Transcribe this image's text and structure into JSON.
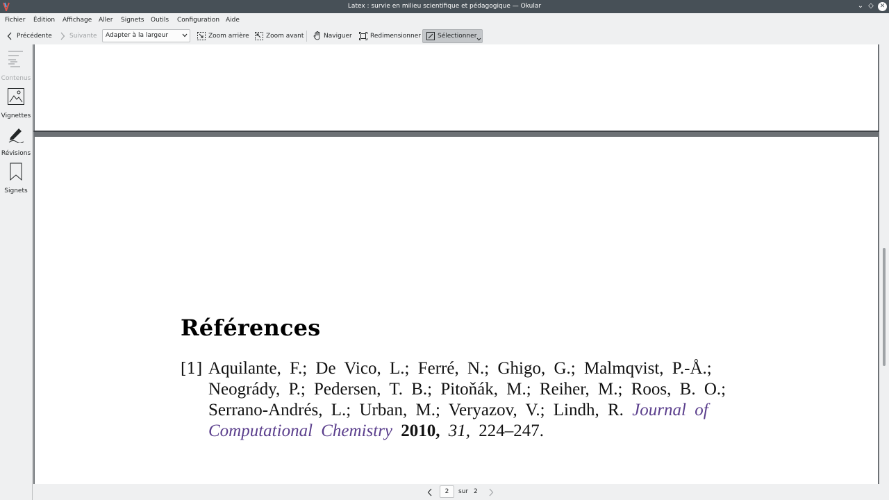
{
  "window": {
    "title": "Latex : survie en milieu scientifique et pédagogique — Okular",
    "controls": {
      "minimize": "⌄",
      "maximize": "◇",
      "close": "✕"
    }
  },
  "menubar": {
    "items": [
      "Fichier",
      "Édition",
      "Affichage",
      "Aller",
      "Signets",
      "Outils",
      "Configuration",
      "Aide"
    ]
  },
  "toolbar": {
    "previous": "Précédente",
    "next": "Suivante",
    "zoom_mode": "Adapter à la largeur",
    "zoom_out": "Zoom arrière",
    "zoom_in": "Zoom avant",
    "browse": "Naviguer",
    "resize": "Redimensionner",
    "select": "Sélectionner"
  },
  "sidebar": {
    "items": [
      {
        "label": "Contenus",
        "icon": "table-of-contents-icon",
        "enabled": false
      },
      {
        "label": "Vignettes",
        "icon": "thumbnails-icon",
        "enabled": true
      },
      {
        "label": "Révisions",
        "icon": "annotations-pen-icon",
        "enabled": true
      },
      {
        "label": "Signets",
        "icon": "bookmark-icon",
        "enabled": true
      }
    ]
  },
  "document": {
    "heading": "Références",
    "reference": {
      "number": "[1]",
      "lines": [
        "Aquilante, F.; De Vico, L.; Ferré, N.; Ghigo, G.; Malmqvist, P.-Å.;",
        "Neogrády, P.; Pedersen, T. B.; Pitoňák, M.; Reiher, M.; Roos, B. O.;",
        "Serrano-Andrés, L.; Urban, M.; Veryazov, V.; Lindh, R."
      ],
      "journal_part1": "Journal of",
      "journal_part2": "Computational Chemistry",
      "year": "2010,",
      "volume": "31,",
      "pages": "224–247."
    }
  },
  "pagebar": {
    "current_page": "2",
    "of_label": "sur",
    "total_pages": "2"
  },
  "colors": {
    "titlebar": "#475057",
    "journal_link": "#5a3e8c",
    "viewport_bg": "#6d7175"
  }
}
